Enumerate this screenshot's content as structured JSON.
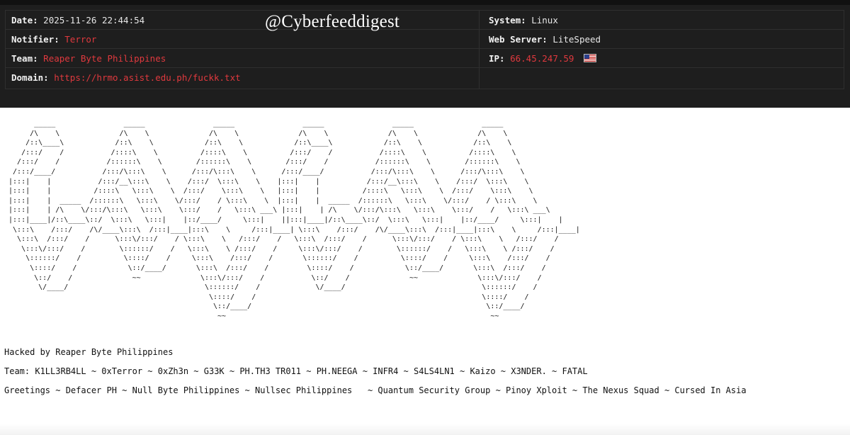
{
  "watermark": "@Cyberfeeddigest",
  "header": {
    "date_label": "Date:",
    "date_value": "2025-11-26 22:44:54",
    "notifier_label": "Notifier:",
    "notifier_value": "Terror",
    "team_label": "Team:",
    "team_value": "Reaper Byte Philippines",
    "domain_label": "Domain:",
    "domain_value": "https://hrmo.asist.edu.ph/fuckk.txt",
    "system_label": "System:",
    "system_value": "Linux",
    "webserver_label": "Web Server:",
    "webserver_value": "LiteSpeed",
    "ip_label": "IP:",
    "ip_value": "66.45.247.59",
    "ip_flag_icon": "us-flag-icon"
  },
  "ascii_art": "       _____                _____                _____                _____                _____                _____\n      /\\    \\              /\\    \\              /\\    \\              /\\    \\              /\\    \\              /\\    \\\n     /::\\____\\            /::\\    \\            /::\\    \\            /::\\____\\            /::\\    \\            /::\\    \\\n    /:::/    /           /::::\\    \\          /::::\\    \\          /:::/    /           /::::\\    \\          /::::\\    \\\n   /:::/    /           /::::::\\    \\        /::::::\\    \\        /:::/    /           /::::::\\    \\        /::::::\\    \\\n  /:::/____/           /:::/\\:::\\    \\      /:::/\\:::\\    \\      /:::/____/           /:::/\\:::\\    \\      /:::/\\:::\\    \\\n |:::|    |           /:::/__\\:::\\    \\    /:::/  \\:::\\    \\    |:::|    |           /:::/__\\:::\\    \\    /:::/  \\:::\\    \\\n |:::|    |          /::::\\   \\:::\\    \\  /:::/    \\:::\\    \\   |:::|    |          /::::\\   \\:::\\    \\  /:::/    \\:::\\    \\\n |:::|    |  _____  /::::::\\   \\:::\\    \\/:::/    / \\:::\\    \\  |:::|    |  _____  /::::::\\   \\:::\\    \\/:::/    / \\:::\\    \\\n |:::|    | /\\    \\/:::/\\:::\\   \\:::\\    \\:::/    /   \\:::\\ ___\\ |:::|    | /\\    \\/:::/\\:::\\   \\:::\\    \\:::/    /   \\:::\\ ___\\\n |:::|____|/::\\____\\::/  \\:::\\   \\:::|    |::/____/     \\:::|    ||:::|____|/::\\____\\::/  \\:::\\   \\:::|    |::/____/     \\:::|    |\n  \\:::\\    /:::/    /\\/____\\:::\\  /:::|____|:::\\    \\     /:::|____| \\:::\\    /:::/    /\\/____\\:::\\  /:::|____|:::\\    \\     /:::|____|\n   \\:::\\  /:::/    /      \\:::\\/:::/    / \\:::\\    \\   /:::/    /   \\:::\\  /:::/    /      \\:::\\/:::/    / \\:::\\    \\   /:::/    /\n    \\:::\\/:::/    /        \\::::::/    /   \\:::\\    \\ /:::/    /     \\:::\\/:::/    /        \\::::::/    /   \\:::\\    \\ /:::/    /\n     \\::::::/    /          \\::::/    /     \\:::\\    /:::/    /       \\::::::/    /          \\::::/    /     \\:::\\    /:::/    /\n      \\::::/    /            \\::/____/       \\:::\\  /:::/    /         \\::::/    /            \\::/____/       \\:::\\  /:::/    /\n       \\::/    /              ~~              \\:::\\/:::/    /           \\::/    /              ~~              \\:::\\/:::/    /\n        \\/____/                                \\::::::/    /             \\/____/                                \\::::::/    /\n                                                \\::::/    /                                                     \\::::/    /\n                                                 \\::/____/                                                       \\::/____/\n                                                  ~~                                                              ~~",
  "messages": {
    "hacked": "Hacked by Reaper Byte Philippines",
    "team": "Team: K1LL3RB4LL ~ 0xTerror ~ 0xZh3n ~ G33K ~ PH.TH3 TR011 ~ PH.NEEGA ~ INFR4 ~ S4LS4LN1 ~ Kaizo ~ X3NDER. ~ FATAL",
    "greetings": "Greetings ~ Defacer PH ~ Null Byte Philippines ~ Nullsec Philippines   ~ Quantum Security Group ~ Pinoy Xploit ~ The Nexus Squad ~ Cursed In Asia"
  }
}
